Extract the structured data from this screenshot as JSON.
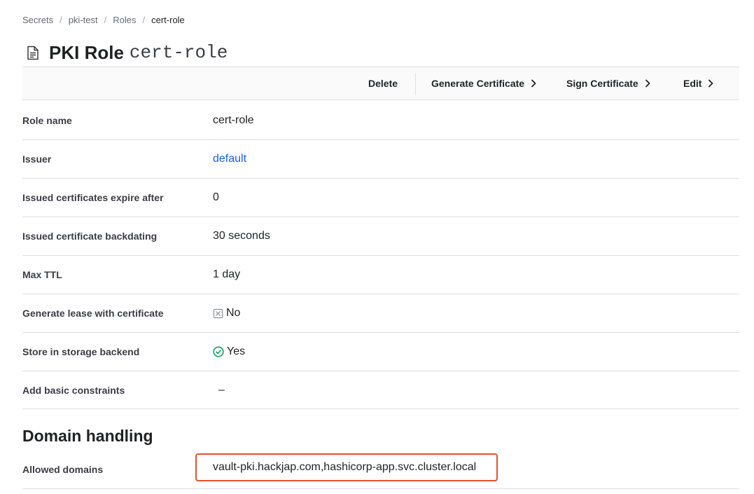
{
  "breadcrumb": {
    "items": [
      "Secrets",
      "pki-test",
      "Roles"
    ],
    "current": "cert-role",
    "separator": "/"
  },
  "header": {
    "title": "PKI Role",
    "role_id": "cert-role",
    "icon": "file-text-icon"
  },
  "toolbar": {
    "delete_label": "Delete",
    "generate_label": "Generate Certificate",
    "sign_label": "Sign Certificate",
    "edit_label": "Edit"
  },
  "details": [
    {
      "label": "Role name",
      "value": "cert-role"
    },
    {
      "label": "Issuer",
      "value": "default"
    },
    {
      "label": "Issued certificates expire after",
      "value": "0"
    },
    {
      "label": "Issued certificate backdating",
      "value": "30 seconds"
    },
    {
      "label": "Max TTL",
      "value": "1 day"
    },
    {
      "label": "Generate lease with certificate",
      "value": "No"
    },
    {
      "label": "Store in storage backend",
      "value": "Yes"
    },
    {
      "label": "Add basic constraints",
      "value": "–"
    }
  ],
  "domain_handling": {
    "title": "Domain handling",
    "allowed_domains_label": "Allowed domains",
    "allowed_domains_value": "vault-pki.hackjap.com,hashicorp-app.svc.cluster.local"
  },
  "colors": {
    "link": "#1060ff",
    "success": "#00a052",
    "highlight": "#e5502e",
    "border": "#dedfe3"
  }
}
